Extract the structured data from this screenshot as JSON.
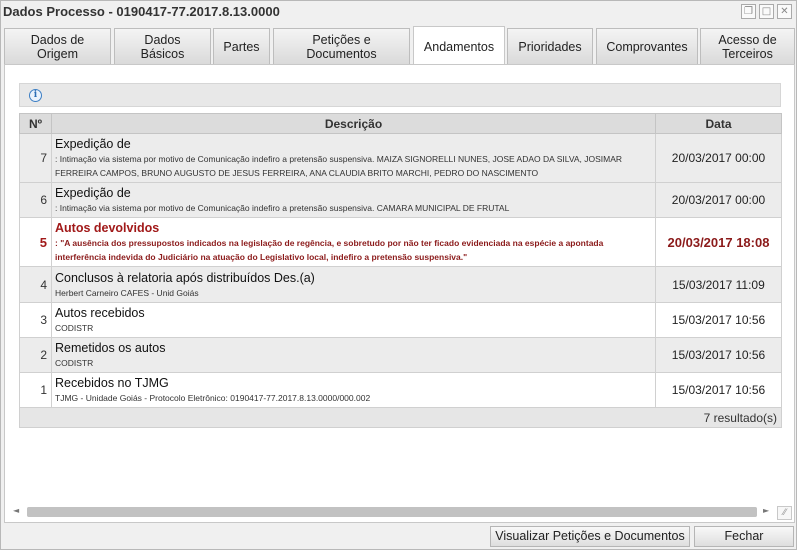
{
  "window": {
    "title": "Dados Processo - 0190417-77.2017.8.13.0000",
    "restore_glyph": "❐",
    "maximize_glyph": "□",
    "close_glyph": "✕"
  },
  "tabs": [
    {
      "label": "Dados de\nOrigem"
    },
    {
      "label": "Dados\nBásicos"
    },
    {
      "label": "Partes"
    },
    {
      "label": "Petições e\nDocumentos"
    },
    {
      "label": "Andamentos",
      "active": true
    },
    {
      "label": "Prioridades"
    },
    {
      "label": "Comprovantes"
    },
    {
      "label": "Acesso de\nTerceiros"
    }
  ],
  "toolbar": {
    "info_icon": "info-icon",
    "info_glyph": "i"
  },
  "table": {
    "headers": {
      "num": "Nº",
      "desc": "Descrição",
      "date": "Data"
    },
    "rows": [
      {
        "num": "7",
        "title": "Expedição de",
        "sub": ": Intimação via sistema por motivo de Comunicação indefiro a pretensão suspensiva. MAIZA SIGNORELLI NUNES, JOSE ADAO DA SILVA, JOSIMAR FERREIRA CAMPOS, BRUNO AUGUSTO DE JESUS FERREIRA, ANA CLAUDIA BRITO MARCHI, PEDRO DO NASCIMENTO",
        "date": "20/03/2017 00:00"
      },
      {
        "num": "6",
        "title": "Expedição de",
        "sub": ": Intimação via sistema por motivo de Comunicação indefiro a pretensão suspensiva. CAMARA MUNICIPAL DE FRUTAL",
        "date": "20/03/2017 00:00"
      },
      {
        "num": "5",
        "title": "Autos devolvidos",
        "sub": ": \"A ausência dos pressupostos indicados na legislação de regência, e sobretudo por não ter ficado evidenciada na espécie a apontada interferência indevida do Judiciário na atuação do Legislativo local, indefiro a pretensão suspensiva.\"",
        "date": "20/03/2017 18:08"
      },
      {
        "num": "4",
        "title": "Conclusos à relatoria após distribuídos Des.(a)",
        "sub": "Herbert Carneiro CAFES - Unid Goiás",
        "date": "15/03/2017 11:09"
      },
      {
        "num": "3",
        "title": "Autos recebidos",
        "sub": "CODISTR",
        "date": "15/03/2017 10:56"
      },
      {
        "num": "2",
        "title": "Remetidos os autos",
        "sub": "CODISTR",
        "date": "15/03/2017 10:56"
      },
      {
        "num": "1",
        "title": "Recebidos no TJMG",
        "sub": "TJMG - Unidade Goiás - Protocolo Eletrônico: 0190417-77.2017.8.13.0000/000.002",
        "date": "15/03/2017 10:56"
      }
    ],
    "footer": "7 resultado(s)"
  },
  "scrollbar": {
    "left_glyph": "◄",
    "right_glyph": "►",
    "grip_glyph": "⁄⁄"
  },
  "buttons": {
    "view_docs": "Visualizar Petições e Documentos",
    "close": "Fechar"
  }
}
